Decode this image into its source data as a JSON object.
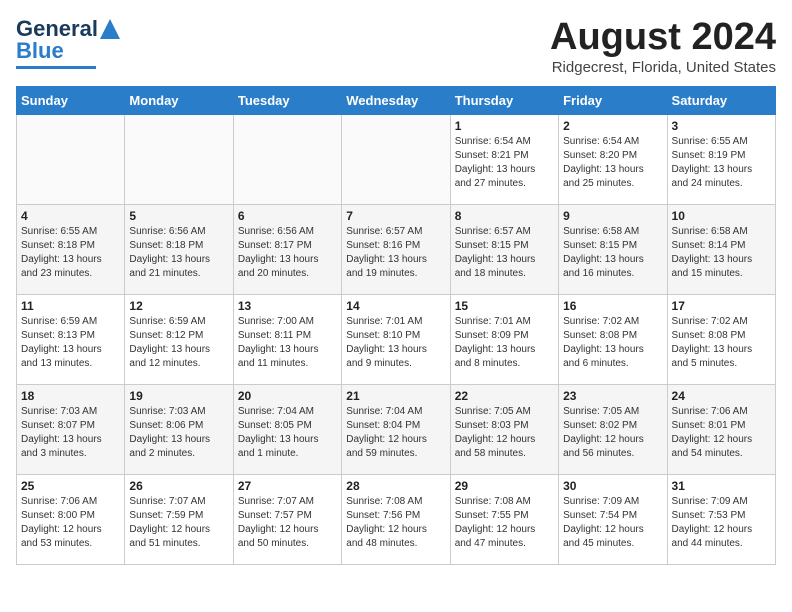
{
  "header": {
    "logo_line1": "General",
    "logo_line2": "Blue",
    "title": "August 2024",
    "subtitle": "Ridgecrest, Florida, United States"
  },
  "weekdays": [
    "Sunday",
    "Monday",
    "Tuesday",
    "Wednesday",
    "Thursday",
    "Friday",
    "Saturday"
  ],
  "weeks": [
    [
      {
        "day": "",
        "info": ""
      },
      {
        "day": "",
        "info": ""
      },
      {
        "day": "",
        "info": ""
      },
      {
        "day": "",
        "info": ""
      },
      {
        "day": "1",
        "info": "Sunrise: 6:54 AM\nSunset: 8:21 PM\nDaylight: 13 hours\nand 27 minutes."
      },
      {
        "day": "2",
        "info": "Sunrise: 6:54 AM\nSunset: 8:20 PM\nDaylight: 13 hours\nand 25 minutes."
      },
      {
        "day": "3",
        "info": "Sunrise: 6:55 AM\nSunset: 8:19 PM\nDaylight: 13 hours\nand 24 minutes."
      }
    ],
    [
      {
        "day": "4",
        "info": "Sunrise: 6:55 AM\nSunset: 8:18 PM\nDaylight: 13 hours\nand 23 minutes."
      },
      {
        "day": "5",
        "info": "Sunrise: 6:56 AM\nSunset: 8:18 PM\nDaylight: 13 hours\nand 21 minutes."
      },
      {
        "day": "6",
        "info": "Sunrise: 6:56 AM\nSunset: 8:17 PM\nDaylight: 13 hours\nand 20 minutes."
      },
      {
        "day": "7",
        "info": "Sunrise: 6:57 AM\nSunset: 8:16 PM\nDaylight: 13 hours\nand 19 minutes."
      },
      {
        "day": "8",
        "info": "Sunrise: 6:57 AM\nSunset: 8:15 PM\nDaylight: 13 hours\nand 18 minutes."
      },
      {
        "day": "9",
        "info": "Sunrise: 6:58 AM\nSunset: 8:15 PM\nDaylight: 13 hours\nand 16 minutes."
      },
      {
        "day": "10",
        "info": "Sunrise: 6:58 AM\nSunset: 8:14 PM\nDaylight: 13 hours\nand 15 minutes."
      }
    ],
    [
      {
        "day": "11",
        "info": "Sunrise: 6:59 AM\nSunset: 8:13 PM\nDaylight: 13 hours\nand 13 minutes."
      },
      {
        "day": "12",
        "info": "Sunrise: 6:59 AM\nSunset: 8:12 PM\nDaylight: 13 hours\nand 12 minutes."
      },
      {
        "day": "13",
        "info": "Sunrise: 7:00 AM\nSunset: 8:11 PM\nDaylight: 13 hours\nand 11 minutes."
      },
      {
        "day": "14",
        "info": "Sunrise: 7:01 AM\nSunset: 8:10 PM\nDaylight: 13 hours\nand 9 minutes."
      },
      {
        "day": "15",
        "info": "Sunrise: 7:01 AM\nSunset: 8:09 PM\nDaylight: 13 hours\nand 8 minutes."
      },
      {
        "day": "16",
        "info": "Sunrise: 7:02 AM\nSunset: 8:08 PM\nDaylight: 13 hours\nand 6 minutes."
      },
      {
        "day": "17",
        "info": "Sunrise: 7:02 AM\nSunset: 8:08 PM\nDaylight: 13 hours\nand 5 minutes."
      }
    ],
    [
      {
        "day": "18",
        "info": "Sunrise: 7:03 AM\nSunset: 8:07 PM\nDaylight: 13 hours\nand 3 minutes."
      },
      {
        "day": "19",
        "info": "Sunrise: 7:03 AM\nSunset: 8:06 PM\nDaylight: 13 hours\nand 2 minutes."
      },
      {
        "day": "20",
        "info": "Sunrise: 7:04 AM\nSunset: 8:05 PM\nDaylight: 13 hours\nand 1 minute."
      },
      {
        "day": "21",
        "info": "Sunrise: 7:04 AM\nSunset: 8:04 PM\nDaylight: 12 hours\nand 59 minutes."
      },
      {
        "day": "22",
        "info": "Sunrise: 7:05 AM\nSunset: 8:03 PM\nDaylight: 12 hours\nand 58 minutes."
      },
      {
        "day": "23",
        "info": "Sunrise: 7:05 AM\nSunset: 8:02 PM\nDaylight: 12 hours\nand 56 minutes."
      },
      {
        "day": "24",
        "info": "Sunrise: 7:06 AM\nSunset: 8:01 PM\nDaylight: 12 hours\nand 54 minutes."
      }
    ],
    [
      {
        "day": "25",
        "info": "Sunrise: 7:06 AM\nSunset: 8:00 PM\nDaylight: 12 hours\nand 53 minutes."
      },
      {
        "day": "26",
        "info": "Sunrise: 7:07 AM\nSunset: 7:59 PM\nDaylight: 12 hours\nand 51 minutes."
      },
      {
        "day": "27",
        "info": "Sunrise: 7:07 AM\nSunset: 7:57 PM\nDaylight: 12 hours\nand 50 minutes."
      },
      {
        "day": "28",
        "info": "Sunrise: 7:08 AM\nSunset: 7:56 PM\nDaylight: 12 hours\nand 48 minutes."
      },
      {
        "day": "29",
        "info": "Sunrise: 7:08 AM\nSunset: 7:55 PM\nDaylight: 12 hours\nand 47 minutes."
      },
      {
        "day": "30",
        "info": "Sunrise: 7:09 AM\nSunset: 7:54 PM\nDaylight: 12 hours\nand 45 minutes."
      },
      {
        "day": "31",
        "info": "Sunrise: 7:09 AM\nSunset: 7:53 PM\nDaylight: 12 hours\nand 44 minutes."
      }
    ]
  ]
}
